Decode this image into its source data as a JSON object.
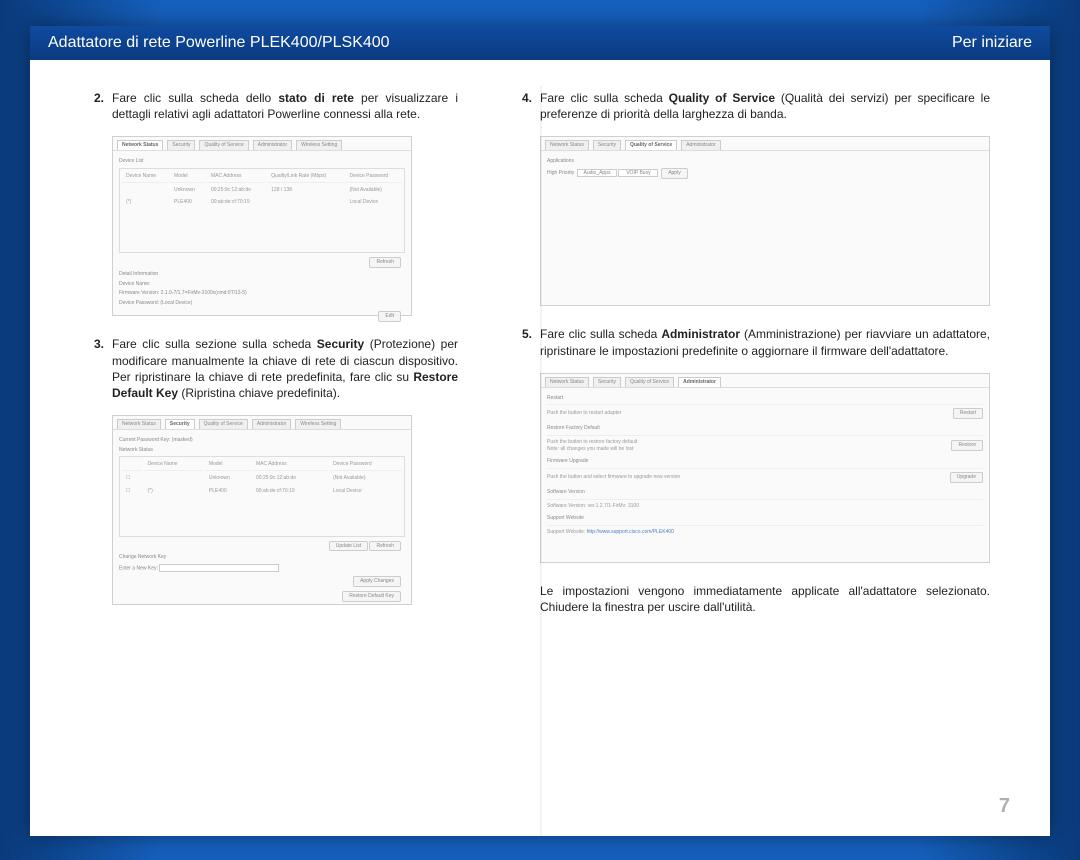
{
  "header": {
    "left": "Adattatore di rete Powerline PLEK400/PLSK400",
    "right": "Per iniziare"
  },
  "steps": {
    "s2": {
      "num": "2.",
      "pre": "Fare clic sulla scheda dello ",
      "bold": "stato di rete",
      "post": " per visualizzare i dettagli relativi agli adattatori Powerline connessi alla rete."
    },
    "s3": {
      "num": "3.",
      "pre": "Fare clic sulla sezione sulla scheda ",
      "bold1": "Security",
      "mid": " (Protezione) per modificare manualmente la chiave di rete di ciascun dispositivo. Per ripristinare la chiave di rete predefinita, fare clic su ",
      "bold2": "Restore Default Key",
      "post": " (Ripristina chiave predefinita)."
    },
    "s4": {
      "num": "4.",
      "pre": "Fare clic sulla scheda ",
      "bold": "Quality of Service",
      "post": " (Qualità dei servizi) per specificare le preferenze di priorità della larghezza di banda."
    },
    "s5": {
      "num": "5.",
      "pre": "Fare clic sulla scheda ",
      "bold": "Administrator",
      "post": " (Amministrazione) per riavviare un adattatore, ripristinare le impostazioni predefinite o aggiornare il firmware dell'adattatore."
    }
  },
  "footer_note": "Le impostazioni vengono immediatamente applicate all'adattatore selezionato. Chiudere la finestra per uscire dall'utilità.",
  "page_num": "7",
  "ss1": {
    "tabs": [
      "Network Status",
      "Security",
      "Quality of Service",
      "Administrator",
      "Wireless Setting"
    ],
    "section": "Device List",
    "cols": [
      "Device Name",
      "Model",
      "MAC Address",
      "Quality/Link Rate (Mbps)",
      "Device Password"
    ],
    "row1": [
      "Unknown",
      "00:25:9c:12:ab:de",
      "128 / 138",
      "(Not Available)"
    ],
    "row2": [
      "PLE400",
      "00:ab:de:cf:70:19",
      "",
      "Local Device"
    ],
    "btn_refresh": "Refresh",
    "detail": "Detail Information",
    "dname": "Device Name:",
    "fw": "Firmware Version:  2.1.0-7/1.7=FirMv-3100c(cmd:0T/13-5)",
    "dpw": "Device Password:  (Local Device)",
    "btn_edit": "Edit"
  },
  "ss2": {
    "tabs": [
      "Network Status",
      "Security",
      "Quality of Service",
      "Administrator",
      "Wireless Setting"
    ],
    "cpw": "Current Password Key:   (masked)",
    "nstatus": "Network Status",
    "cols": [
      "Device Name",
      "Model",
      "MAC Address",
      "Device Password"
    ],
    "row1": [
      "Unknown",
      "00:25:9c:12:ab:de",
      "(Not Available)"
    ],
    "row2": [
      "PLE400",
      "00:ab:de:cf:70:19",
      "Local Device"
    ],
    "btn_update": "Update List",
    "btn_refresh": "Refresh",
    "change": "Change Network Key",
    "enter": "Enter a New Key:",
    "btn_apply": "Apply Changes",
    "btn_restore": "Restore Default Key"
  },
  "ss3": {
    "tabs": [
      "Network Status",
      "Security",
      "Quality of Service",
      "Administrator"
    ],
    "applic": "Applications",
    "pri": "High Priority",
    "opt1": "Audio_Apps",
    "opt2": "VOIP Busy",
    "btn_apply": "Apply"
  },
  "ss4": {
    "tabs": [
      "Network Status",
      "Security",
      "Quality of Service",
      "Administrator"
    ],
    "restart_h": "Restart",
    "restart_t": "Push the button to restart adapter",
    "btn_restart": "Restart",
    "rfd_h": "Restore Factory Default",
    "rfd_t1": "Push the button to restore factory default",
    "rfd_t2": "Note: all changes you made will be lost",
    "btn_restore": "Restore",
    "fw_h": "Firmware Upgrade",
    "fw_t": "Push the button and select firmware to upgrade new version",
    "btn_upgrade": "Upgrade",
    "sv_h": "Software Version",
    "sv_t": "Software Version:   ver.1.2.7/1-FirMv: 3100",
    "sw_h": "Support Website",
    "sw_t": "Support Website:",
    "sw_link": "http://www.support.cisco.com/PLEK400"
  }
}
